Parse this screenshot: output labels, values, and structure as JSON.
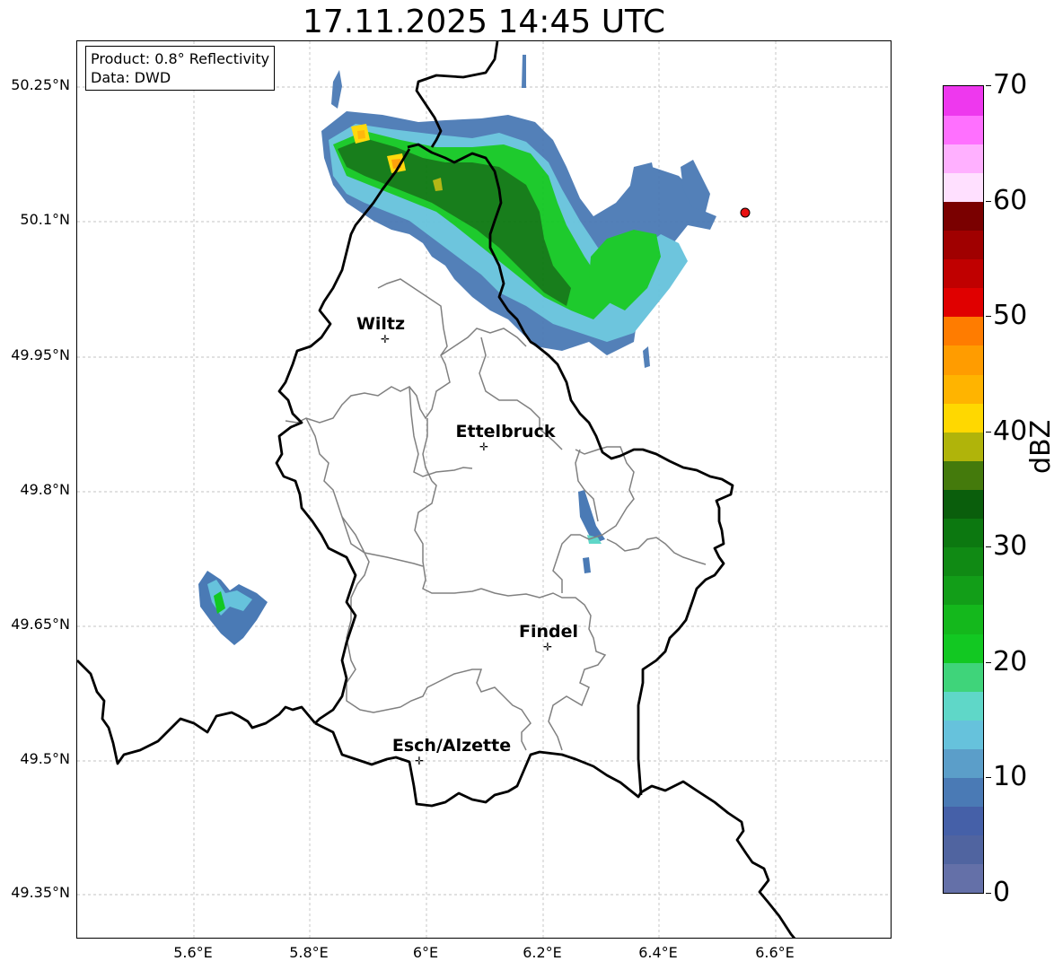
{
  "title": "17.11.2025 14:45 UTC",
  "info_box": {
    "line1": "Product: 0.8° Reflectivity",
    "line2": "Data: DWD"
  },
  "lat_ticks": [
    "50.25°N",
    "50.1°N",
    "49.95°N",
    "49.8°N",
    "49.65°N",
    "49.5°N",
    "49.35°N"
  ],
  "lon_ticks": [
    "5.6°E",
    "5.8°E",
    "6°E",
    "6.2°E",
    "6.4°E",
    "6.6°E"
  ],
  "cities": [
    {
      "name": "Wiltz"
    },
    {
      "name": "Ettelbruck"
    },
    {
      "name": "Findel"
    },
    {
      "name": "Esch/Alzette"
    }
  ],
  "colorbar": {
    "label": "dBZ",
    "ticks": [
      "0",
      "10",
      "20",
      "30",
      "40",
      "50",
      "60",
      "70"
    ],
    "colors": [
      "#6470a8",
      "#5064a0",
      "#4560a8",
      "#4a7ab5",
      "#5b9ec9",
      "#66c2dc",
      "#5fd7c8",
      "#3fd47a",
      "#12c822",
      "#14b81c",
      "#129e18",
      "#108a14",
      "#0c7810",
      "#0a5e0c",
      "#447a0c",
      "#b0b40a",
      "#ffd800",
      "#ffb400",
      "#ff9c00",
      "#ff7c00",
      "#e00000",
      "#c00000",
      "#a00000",
      "#7a0000",
      "#ffe0ff",
      "#ffb0ff",
      "#ff70ff",
      "#ee38ee"
    ]
  },
  "colors": {
    "border_country": "#000000",
    "border_canton": "#808080",
    "grid": "#b0b0b0",
    "marker": "#e81010"
  }
}
